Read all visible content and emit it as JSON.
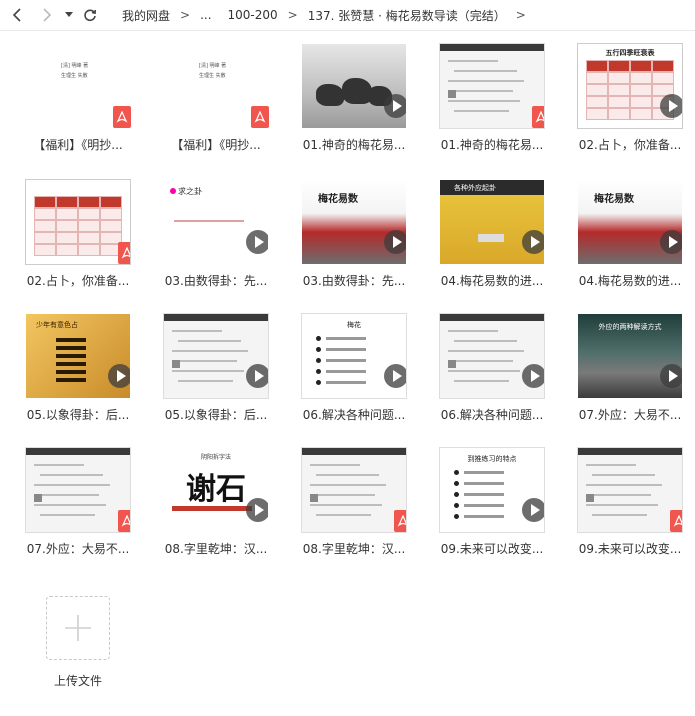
{
  "breadcrumb": {
    "root": "我的网盘",
    "ellipsis": "...",
    "parent": "100-200",
    "current": "137. 张赞慧 · 梅花易数导读（完结）"
  },
  "files": [
    {
      "name": "【福利】《明抄...",
      "kind": "pdf",
      "thumb_text": [
        "[清] 明峰 著",
        "生理生 失散"
      ]
    },
    {
      "name": "【福利】《明抄...",
      "kind": "pdf",
      "thumb_text": [
        "[清] 明峰 著",
        "生理生 失散"
      ]
    },
    {
      "name": "01.神奇的梅花易...",
      "kind": "video",
      "thumb": "horses"
    },
    {
      "name": "01.神奇的梅花易...",
      "kind": "pdf",
      "thumb": "chat"
    },
    {
      "name": "02.占卜，你准备...",
      "kind": "video",
      "thumb": "table",
      "thumb_title": "五行四季旺衰表"
    },
    {
      "name": "02.占卜，你准备...",
      "kind": "pdf",
      "thumb": "sheet"
    },
    {
      "name": "03.由数得卦：先...",
      "kind": "video",
      "thumb": "title",
      "thumb_title": "求之卦"
    },
    {
      "name": "03.由数得卦：先...",
      "kind": "video",
      "thumb": "temple",
      "thumb_title": "梅花易数"
    },
    {
      "name": "04.梅花易数的进...",
      "kind": "video",
      "thumb": "car",
      "thumb_title": "各种外应起卦"
    },
    {
      "name": "04.梅花易数的进...",
      "kind": "video",
      "thumb": "temple",
      "thumb_title": "梅花易数"
    },
    {
      "name": "05.以象得卦：后...",
      "kind": "video",
      "thumb": "gold",
      "thumb_title": "少年有意色占"
    },
    {
      "name": "05.以象得卦：后...",
      "kind": "video",
      "thumb": "chat"
    },
    {
      "name": "06.解决各种问题...",
      "kind": "video",
      "thumb": "list",
      "thumb_title": "梅花"
    },
    {
      "name": "06.解决各种问题...",
      "kind": "video",
      "thumb": "chat"
    },
    {
      "name": "07.外应：大易不...",
      "kind": "video",
      "thumb": "roof",
      "thumb_title": "外应的两种解读方式"
    },
    {
      "name": "07.外应：大易不...",
      "kind": "pdf",
      "thumb": "chat"
    },
    {
      "name": "08.字里乾坤：汉...",
      "kind": "video",
      "thumb": "calli",
      "thumb_title": "谢石",
      "thumb_sub": "阴阳拆字法"
    },
    {
      "name": "08.字里乾坤：汉...",
      "kind": "pdf",
      "thumb": "chat"
    },
    {
      "name": "09.未来可以改变...",
      "kind": "video",
      "thumb": "list",
      "thumb_title": "到推练习的特点"
    },
    {
      "name": "09.未来可以改变...",
      "kind": "pdf",
      "thumb": "chat"
    }
  ],
  "upload": {
    "label": "上传文件"
  },
  "colors": {
    "pdf_badge": "#f0564d",
    "play_button": "#3c3c3c"
  }
}
